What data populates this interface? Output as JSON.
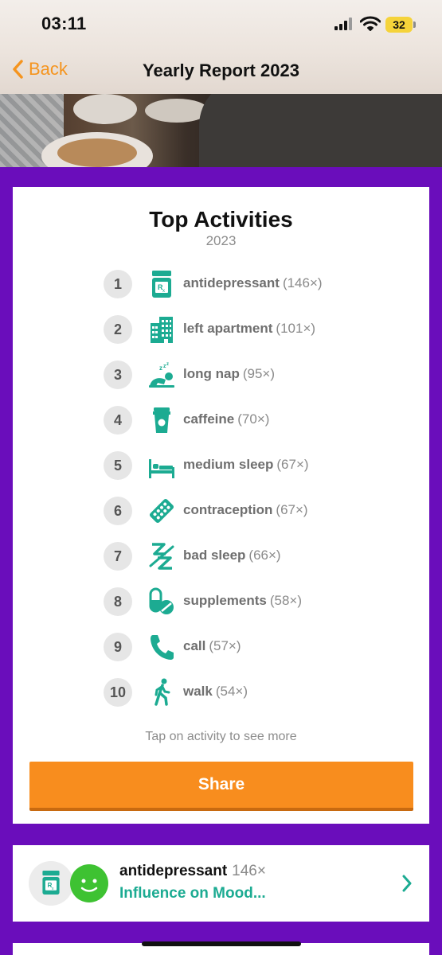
{
  "status": {
    "time": "03:11",
    "battery": "32"
  },
  "nav": {
    "back_label": "Back",
    "title": "Yearly Report 2023"
  },
  "card": {
    "title": "Top Activities",
    "year": "2023",
    "activities": [
      {
        "rank": "1",
        "name": "antidepressant",
        "count": "(146×)",
        "icon": "prescription-bottle-icon"
      },
      {
        "rank": "2",
        "name": "left apartment",
        "count": "(101×)",
        "icon": "building-icon"
      },
      {
        "rank": "3",
        "name": "long nap",
        "count": "(95×)",
        "icon": "sleeping-person-icon"
      },
      {
        "rank": "4",
        "name": "caffeine",
        "count": "(70×)",
        "icon": "coffee-cup-icon"
      },
      {
        "rank": "5",
        "name": "medium sleep",
        "count": "(67×)",
        "icon": "bed-icon"
      },
      {
        "rank": "6",
        "name": "contraception",
        "count": "(67×)",
        "icon": "pill-pack-icon"
      },
      {
        "rank": "7",
        "name": "bad sleep",
        "count": "(66×)",
        "icon": "bad-sleep-zz-icon"
      },
      {
        "rank": "8",
        "name": "supplements",
        "count": "(58×)",
        "icon": "capsule-pill-icon"
      },
      {
        "rank": "9",
        "name": "call",
        "count": "(57×)",
        "icon": "phone-icon"
      },
      {
        "rank": "10",
        "name": "walk",
        "count": "(54×)",
        "icon": "walking-person-icon"
      }
    ],
    "hint": "Tap on activity to see more",
    "share_label": "Share"
  },
  "influence": {
    "title": "antidepressant",
    "count": "146×",
    "subtitle": "Influence on Mood..."
  },
  "colors": {
    "accent_orange": "#f88d1e",
    "teal": "#1cab92",
    "purple_bg": "#6a0dbb",
    "mood_green": "#3ec232"
  }
}
